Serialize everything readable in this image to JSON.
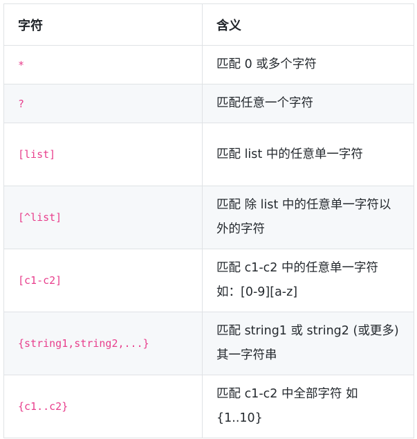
{
  "table": {
    "headers": [
      "字符",
      "含义"
    ],
    "rows": [
      {
        "symbol": "*",
        "meaning": "匹配 0 或多个字符"
      },
      {
        "symbol": "?",
        "meaning": "匹配任意一个字符"
      },
      {
        "symbol": "[list]",
        "meaning": "匹配 list 中的任意单一字符"
      },
      {
        "symbol": "[^list]",
        "meaning": "匹配 除 list 中的任意单一字符以外的字符"
      },
      {
        "symbol": "[c1-c2]",
        "meaning": "匹配 c1-c2 中的任意单一字符 如：[0-9][a-z]"
      },
      {
        "symbol": "{string1,string2,...}",
        "meaning": "匹配 string1 或 string2 (或更多)其一字符串"
      },
      {
        "symbol": "{c1..c2}",
        "meaning": "匹配 c1-c2 中全部字符 如{1..10}"
      }
    ]
  }
}
